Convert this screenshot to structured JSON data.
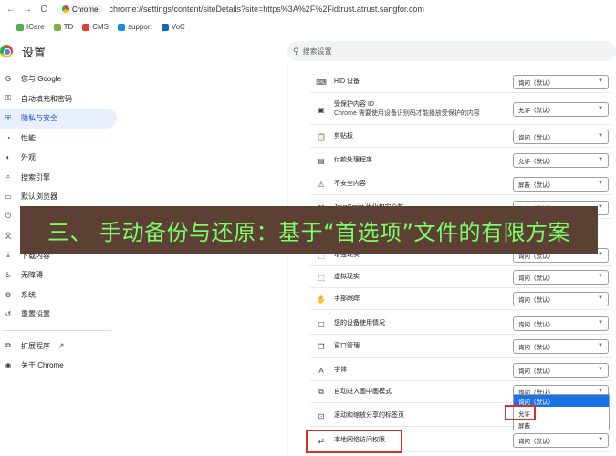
{
  "browser": {
    "nav_back": "←",
    "nav_forward": "→",
    "reload": "C",
    "chip_label": "Chrome",
    "url": "chrome://settings/content/siteDetails?site=https%3A%2F%2Fidtrust.atrust.sangfor.com"
  },
  "bookmarks": [
    {
      "label": "ICare",
      "icon": "leaf-icon",
      "color": "#4caf50"
    },
    {
      "label": "TD",
      "icon": "pin-icon",
      "color": "#7cb342"
    },
    {
      "label": "CMS",
      "icon": "cms-icon",
      "color": "#e53935"
    },
    {
      "label": "support",
      "icon": "globe-icon",
      "color": "#1e88e5"
    },
    {
      "label": "VoC",
      "icon": "voc-icon",
      "color": "#1565c0"
    }
  ],
  "header": {
    "title": "设置",
    "search_placeholder": "搜索设置"
  },
  "sidebar": {
    "items": [
      {
        "label": "您与 Google",
        "icon": "G"
      },
      {
        "label": "自动填充和密码",
        "icon": "⚿"
      },
      {
        "label": "隐私与安全",
        "icon": "⛨",
        "active": true
      },
      {
        "label": "性能",
        "icon": "◔"
      },
      {
        "label": "外观",
        "icon": "◐"
      },
      {
        "label": "搜索引擎",
        "icon": "⌕"
      },
      {
        "label": "默认浏览器",
        "icon": "▭"
      },
      {
        "label": "启动时",
        "icon": "⏻"
      },
      {
        "label": "语言",
        "icon": "文"
      },
      {
        "label": "下载内容",
        "icon": "⤓"
      },
      {
        "label": "无障碍",
        "icon": "♿"
      },
      {
        "label": "系统",
        "icon": "⚙"
      },
      {
        "label": "重置设置",
        "icon": "↺"
      }
    ],
    "extensions": {
      "label": "扩展程序",
      "icon": "⧉",
      "external": "↗"
    },
    "about": {
      "label": "关于 Chrome",
      "icon": "◉"
    }
  },
  "permissions": [
    {
      "label": "HID 设备",
      "sub": "",
      "icon": "⌨",
      "value": "询问（默认）"
    },
    {
      "label": "受保护内容 ID",
      "sub": "Chrome 需要使用设备识别码才能播放受保护的内容",
      "icon": "▣",
      "value": "允许（默认）"
    },
    {
      "label": "剪贴板",
      "sub": "",
      "icon": "📋",
      "value": "询问（默认）"
    },
    {
      "label": "付款处理程序",
      "sub": "",
      "icon": "▤",
      "value": "允许（默认）"
    },
    {
      "label": "不安全内容",
      "sub": "",
      "icon": "⚠",
      "value": "屏蔽（默认）"
    },
    {
      "label": "JavaScript 优化和安全性",
      "sub": "",
      "icon": "⌘",
      "value": "允许（默认）"
    },
    {
      "label": "增强现实",
      "sub": "",
      "icon": "⬚",
      "value": "询问（默认）"
    },
    {
      "label": "虚拟现实",
      "sub": "",
      "icon": "⬚",
      "value": "询问（默认）"
    },
    {
      "label": "手部跟踪",
      "sub": "",
      "icon": "✋",
      "value": "询问（默认）"
    },
    {
      "label": "您的设备使用情况",
      "sub": "",
      "icon": "▢",
      "value": "询问（默认）"
    },
    {
      "label": "窗口管理",
      "sub": "",
      "icon": "❐",
      "value": "询问（默认）"
    },
    {
      "label": "字体",
      "sub": "",
      "icon": "A",
      "value": "询问（默认）"
    },
    {
      "label": "自动进入画中画模式",
      "sub": "",
      "icon": "⧉",
      "value": "询问（默认）"
    },
    {
      "label": "滚动和缩放分享的标签页",
      "sub": "",
      "icon": "⊡",
      "value": "询问（默认）"
    },
    {
      "label": "本地网络访问权限",
      "sub": "",
      "icon": "⇄",
      "value": "询问（默认）"
    }
  ],
  "dropdown_open": {
    "options": [
      "询问（默认）",
      "允许",
      "屏蔽"
    ],
    "highlighted": 0
  },
  "banner": {
    "text": "三、 手动备份与还原：基于“首选项”文件的有限方案",
    "text_color": "#7cfc6a",
    "background": "#5c4033"
  },
  "accent": "#1a73e8",
  "highlight_color": "#d93025"
}
